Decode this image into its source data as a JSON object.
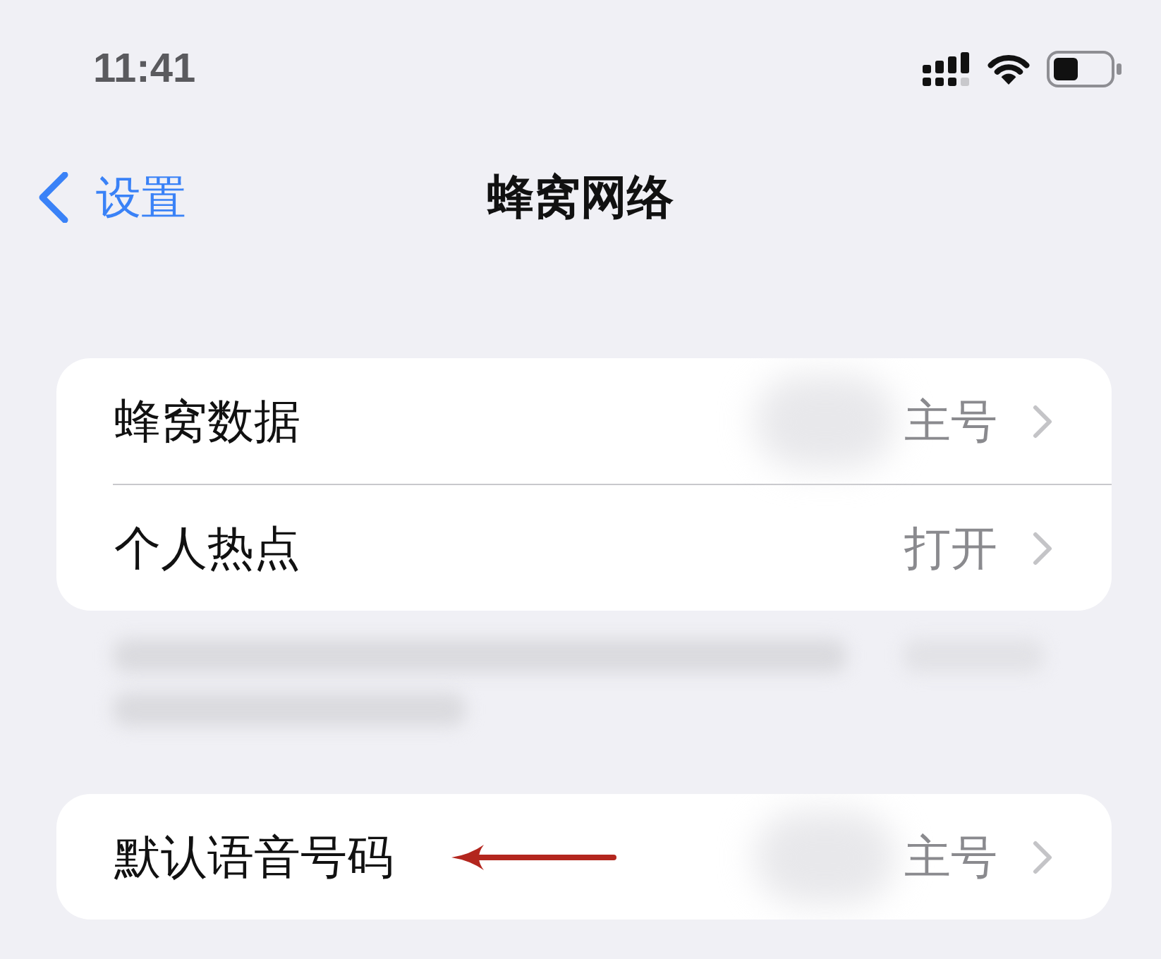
{
  "status_bar": {
    "time": "11:41"
  },
  "nav": {
    "back": "设置",
    "title": "蜂窝网络"
  },
  "groups": [
    {
      "rows": [
        {
          "label": "蜂窝数据",
          "value": "主号",
          "redacted": true,
          "annotated": false
        },
        {
          "label": "个人热点",
          "value": "打开",
          "redacted": false,
          "annotated": false
        }
      ],
      "footer": {
        "kind": "blurred"
      }
    },
    {
      "rows": [
        {
          "label": "默认语音号码",
          "value": "主号",
          "redacted": true,
          "annotated": true
        }
      ]
    }
  ]
}
